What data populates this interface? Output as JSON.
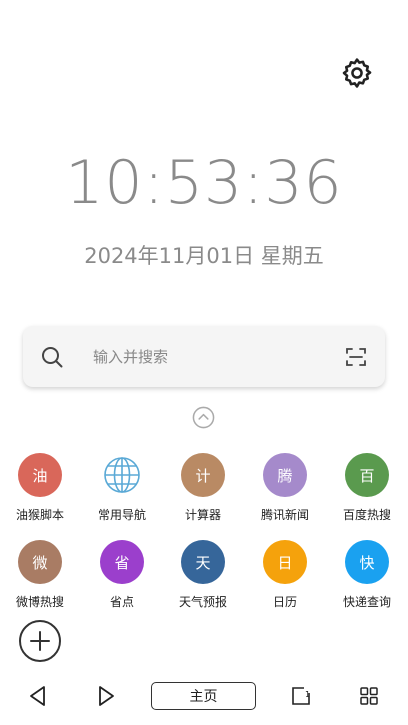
{
  "clock": {
    "time": "10:53:36",
    "date": "2024年11月01日 星期五"
  },
  "search": {
    "placeholder": "输入并搜索",
    "icon": "search-icon",
    "scan_icon": "scan-icon"
  },
  "apps": [
    {
      "label": "油猴脚本",
      "glyph": "油",
      "color": "#d9675a"
    },
    {
      "label": "常用导航",
      "glyph": "globe",
      "color": "#5aa9d6"
    },
    {
      "label": "计算器",
      "glyph": "计",
      "color": "#b98a64"
    },
    {
      "label": "腾讯新闻",
      "glyph": "腾",
      "color": "#a58acb"
    },
    {
      "label": "百度热搜",
      "glyph": "百",
      "color": "#5a9a4e"
    },
    {
      "label": "微博热搜",
      "glyph": "微",
      "color": "#a97c64"
    },
    {
      "label": "省点",
      "glyph": "省",
      "color": "#9b3fcc"
    },
    {
      "label": "天气预报",
      "glyph": "天",
      "color": "#36669a"
    },
    {
      "label": "日历",
      "glyph": "日",
      "color": "#f5a20c"
    },
    {
      "label": "快递查询",
      "glyph": "快",
      "color": "#1aa1f0"
    }
  ],
  "navbar": {
    "home_label": "主页"
  }
}
